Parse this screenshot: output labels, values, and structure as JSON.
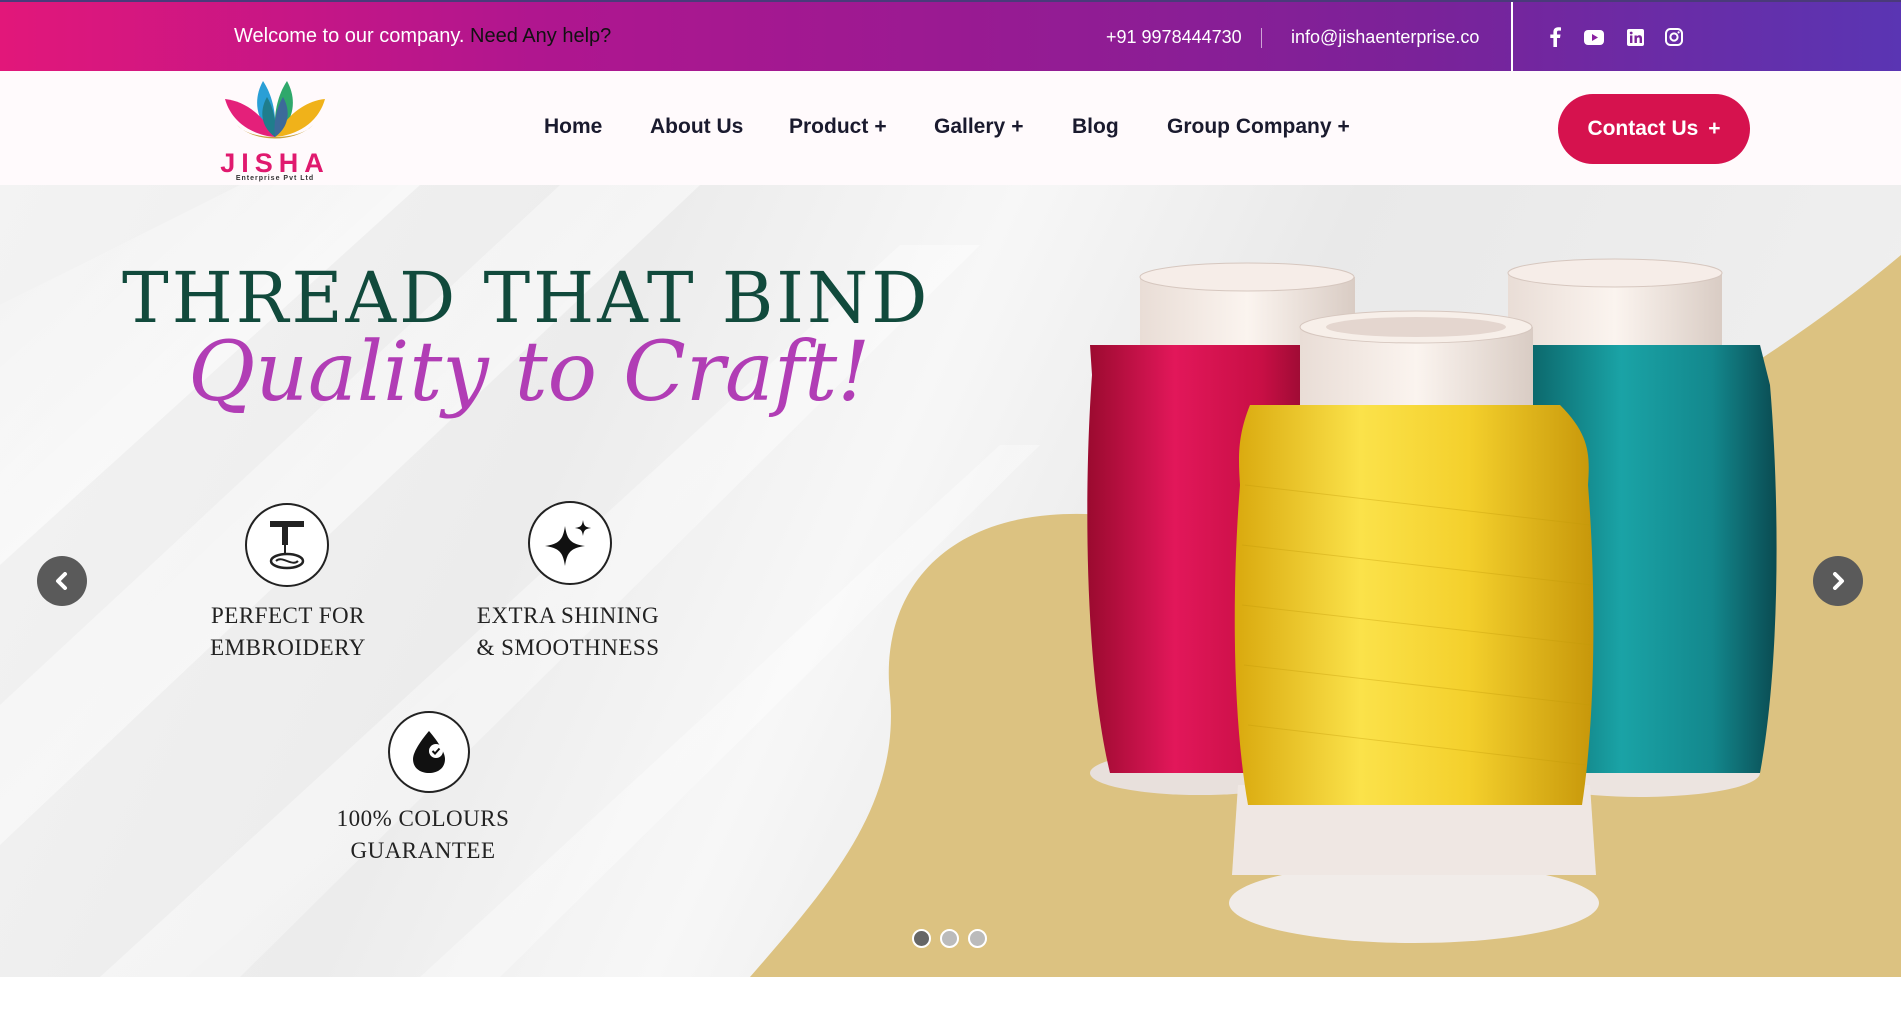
{
  "topbar": {
    "welcome": "Welcome to our company.",
    "help": "Need Any help?",
    "phone": "+91 9978444730",
    "email": "info@jishaenterprise.co",
    "socials": [
      "facebook-icon",
      "youtube-icon",
      "linkedin-icon",
      "instagram-icon"
    ]
  },
  "logo": {
    "name": "JISHA",
    "sub": "Enterprise Pvt Ltd"
  },
  "nav": {
    "items": [
      {
        "label": "Home"
      },
      {
        "label": "About Us"
      },
      {
        "label": "Product",
        "submenu": true
      },
      {
        "label": "Gallery",
        "submenu": true
      },
      {
        "label": "Blog"
      },
      {
        "label": "Group Company",
        "submenu": true
      }
    ],
    "submenu_marker": "+",
    "contact": "Contact Us"
  },
  "hero": {
    "headline": "THREAD THAT BIND",
    "subheadline": "Quality to Craft!",
    "features": [
      {
        "icon": "embroidery-machine-icon",
        "line1": "PERFECT FOR",
        "line2": "EMBROIDERY"
      },
      {
        "icon": "sparkle-icon",
        "line1": "EXTRA SHINING",
        "line2": "& SMOOTHNESS"
      },
      {
        "icon": "colour-drop-icon",
        "line1": "100% COLOURS",
        "line2": "GUARANTEE"
      }
    ],
    "slides": 3,
    "active_slide": 1
  },
  "colors": {
    "brand_pink": "#e2177a",
    "brand_purple": "#5a35b3",
    "cta_red": "#d6124e",
    "headline_green": "#114a3c",
    "subheadline_purple": "#b13db5",
    "sand": "#dcc281",
    "spool_red": "#d4104a",
    "spool_yellow": "#f2cc2a",
    "spool_teal": "#158e93"
  }
}
